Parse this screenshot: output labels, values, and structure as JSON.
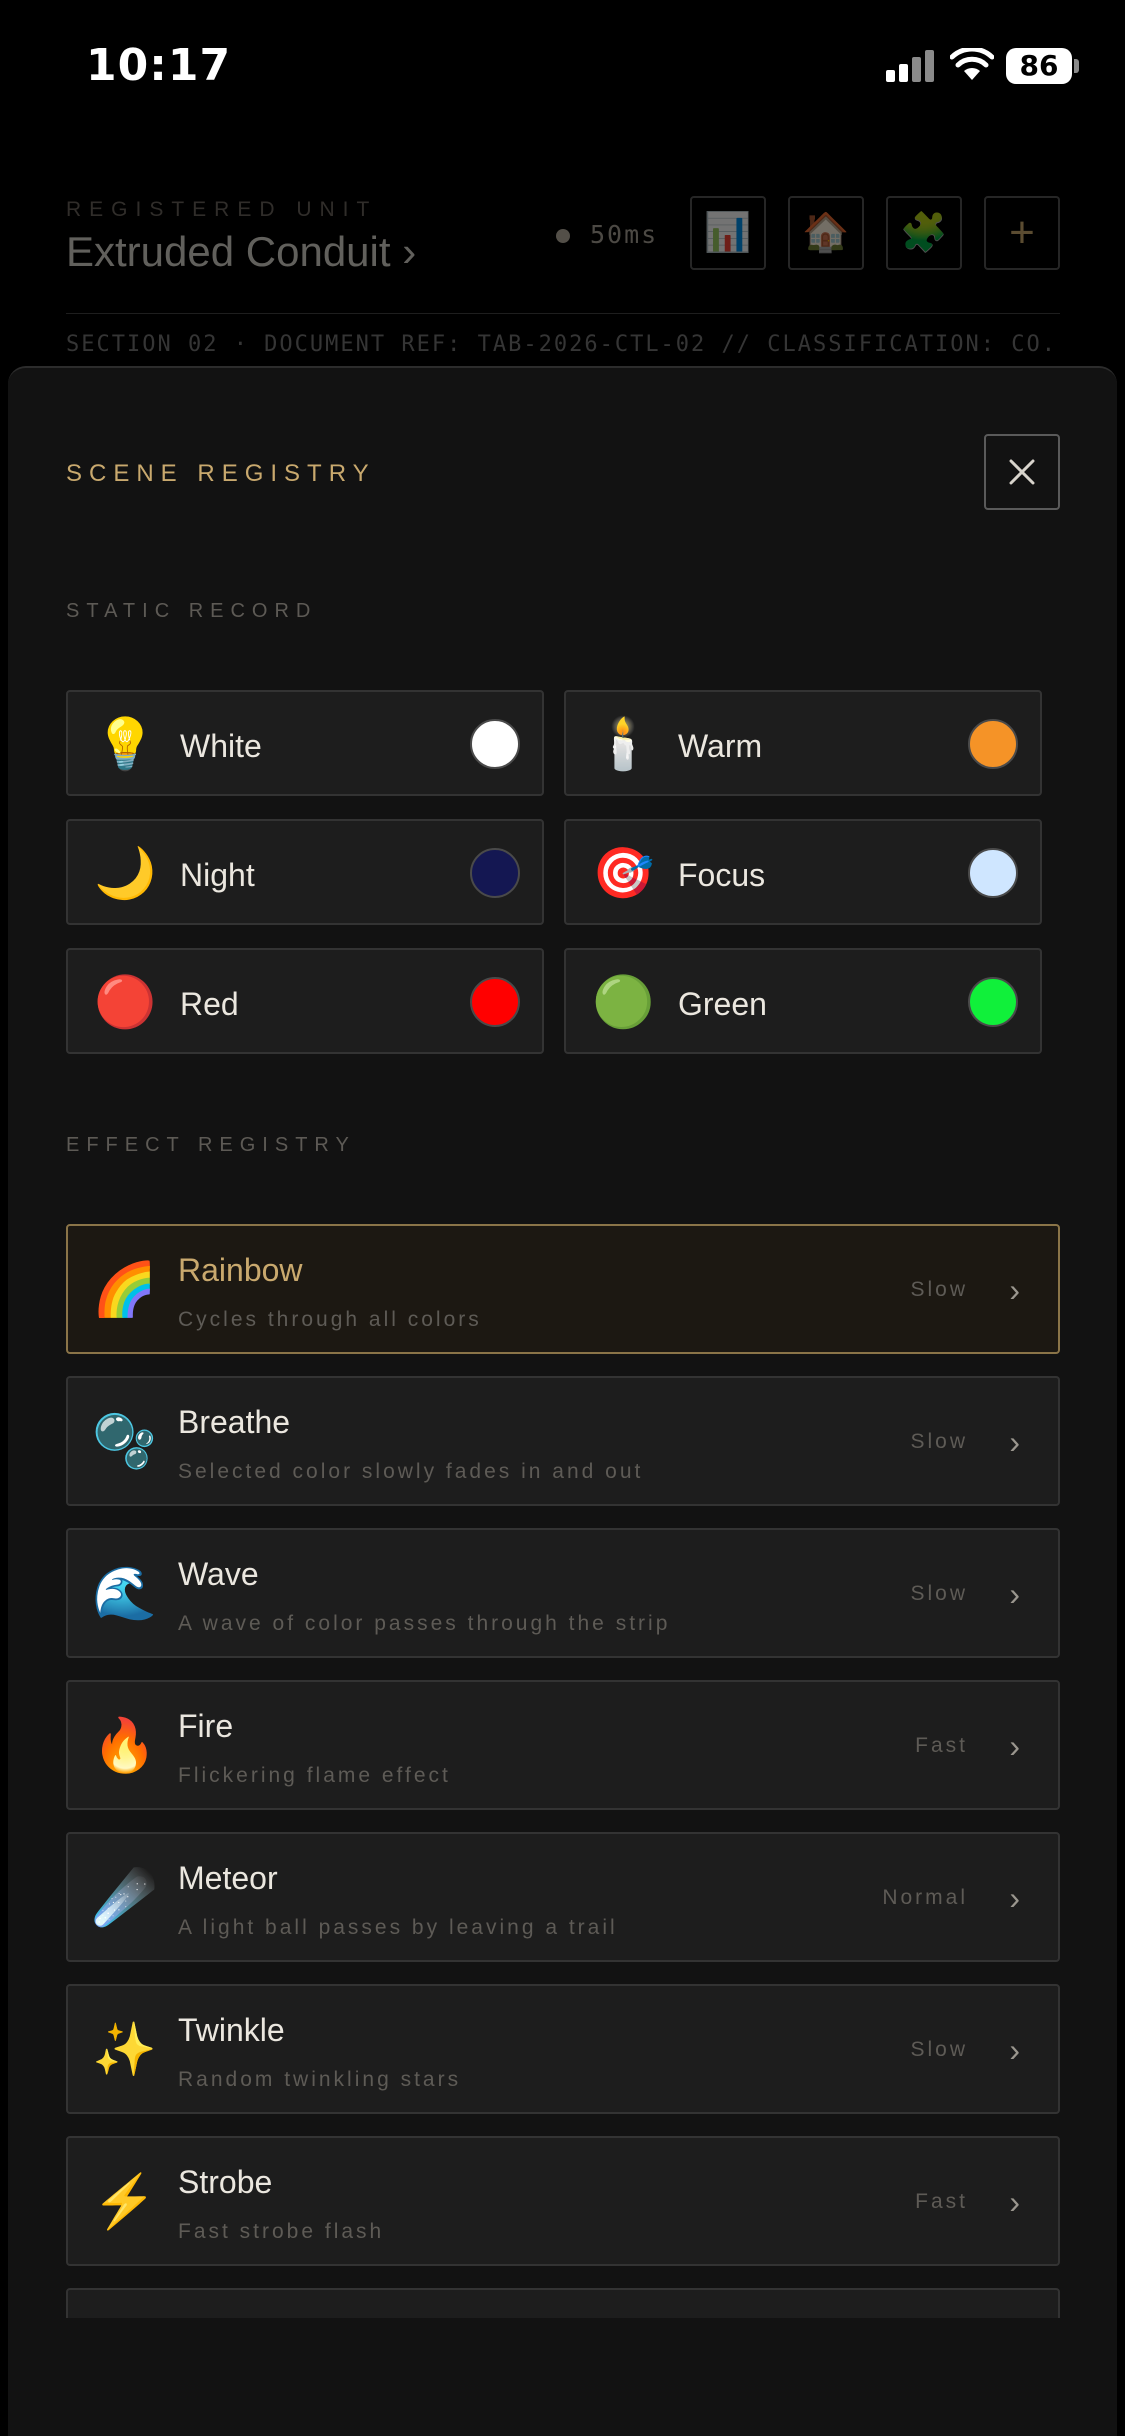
{
  "status_bar": {
    "time": "10:17",
    "battery": "86"
  },
  "header": {
    "registered_label": "REGISTERED UNIT",
    "unit_name": "Extruded Conduit ›",
    "latency": "50ms",
    "buttons": [
      {
        "icon": "bar-chart-icon",
        "glyph": "📊"
      },
      {
        "icon": "house-icon",
        "glyph": "🏠"
      },
      {
        "icon": "puzzle-icon",
        "glyph": "🧩"
      },
      {
        "icon": "plus-icon",
        "glyph": "+"
      }
    ],
    "section_text": "SECTION 02 · DOCUMENT REF: TAB-2026-CTL-02 // CLASSIFICATION: CO..."
  },
  "sheet": {
    "title": "SCENE REGISTRY",
    "static_label": "STATIC RECORD",
    "effect_label": "EFFECT REGISTRY",
    "static_scenes": [
      {
        "name": "White",
        "emoji": "💡",
        "icon": "light-bulb-icon",
        "color": "#ffffff"
      },
      {
        "name": "Warm",
        "emoji": "🕯️",
        "icon": "candle-icon",
        "color": "#f59327"
      },
      {
        "name": "Night",
        "emoji": "🌙",
        "icon": "crescent-moon-icon",
        "color": "#141752"
      },
      {
        "name": "Focus",
        "emoji": "🎯",
        "icon": "target-icon",
        "color": "#cfe6ff"
      },
      {
        "name": "Red",
        "emoji": "🔴",
        "icon": "red-circle-icon",
        "color": "#ff0000"
      },
      {
        "name": "Green",
        "emoji": "🟢",
        "icon": "green-circle-icon",
        "color": "#10f03a"
      }
    ],
    "effects": [
      {
        "name": "Rainbow",
        "desc": "Cycles through all colors",
        "speed": "Slow",
        "emoji": "🌈",
        "icon": "rainbow-icon",
        "active": true
      },
      {
        "name": "Breathe",
        "desc": "Selected color slowly fades in and out",
        "speed": "Slow",
        "emoji": "🫧",
        "icon": "bubbles-icon",
        "active": false
      },
      {
        "name": "Wave",
        "desc": "A wave of color passes through the strip",
        "speed": "Slow",
        "emoji": "🌊",
        "icon": "wave-icon",
        "active": false
      },
      {
        "name": "Fire",
        "desc": "Flickering flame effect",
        "speed": "Fast",
        "emoji": "🔥",
        "icon": "fire-icon",
        "active": false
      },
      {
        "name": "Meteor",
        "desc": "A light ball passes by leaving a trail",
        "speed": "Normal",
        "emoji": "☄️",
        "icon": "comet-icon",
        "active": false
      },
      {
        "name": "Twinkle",
        "desc": "Random twinkling stars",
        "speed": "Slow",
        "emoji": "✨",
        "icon": "sparkles-icon",
        "active": false
      },
      {
        "name": "Strobe",
        "desc": "Fast strobe flash",
        "speed": "Fast",
        "emoji": "⚡",
        "icon": "lightning-icon",
        "active": false
      },
      {
        "name": "",
        "desc": "",
        "speed": "",
        "emoji": "",
        "icon": "",
        "active": false
      }
    ]
  },
  "colors": {
    "accent": "#c9a96e",
    "background": "#000000",
    "sheet": "#121212",
    "card": "#1d1d1d"
  }
}
